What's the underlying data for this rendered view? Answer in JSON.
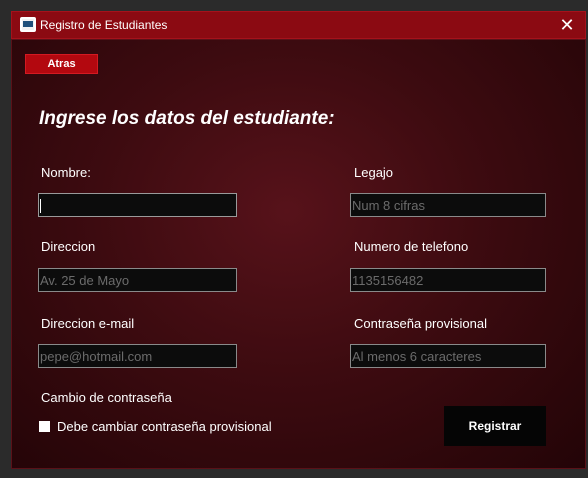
{
  "window": {
    "title": "Registro de Estudiantes",
    "close_symbol": "✕",
    "app_icon": "student-registry-app-icon"
  },
  "toolbar": {
    "back_label": "Atras"
  },
  "form": {
    "heading": "Ingrese los datos del estudiante:",
    "nombre": {
      "label": "Nombre:",
      "value": "",
      "placeholder": ""
    },
    "legajo": {
      "label": "Legajo",
      "value": "",
      "placeholder": "Num 8 cifras"
    },
    "direccion": {
      "label": "Direccion",
      "value": "",
      "placeholder": "Av. 25 de Mayo"
    },
    "telefono": {
      "label": "Numero de telefono",
      "value": "",
      "placeholder": "1135156482"
    },
    "email": {
      "label": "Direccion e-mail",
      "value": "",
      "placeholder": "pepe@hotmail.com"
    },
    "password": {
      "label": "Contraseña provisional",
      "value": "",
      "placeholder": "Al menos 6 caracteres"
    },
    "password_change": {
      "section_label": "Cambio de contraseña",
      "checkbox_label": "Debe cambiar contraseña provisional",
      "checked": false
    },
    "submit_label": "Registrar"
  },
  "colors": {
    "titlebar": "#8b0a12",
    "accent_button": "#b3080f",
    "background_dark": "#230407",
    "background_center": "#57121a"
  }
}
